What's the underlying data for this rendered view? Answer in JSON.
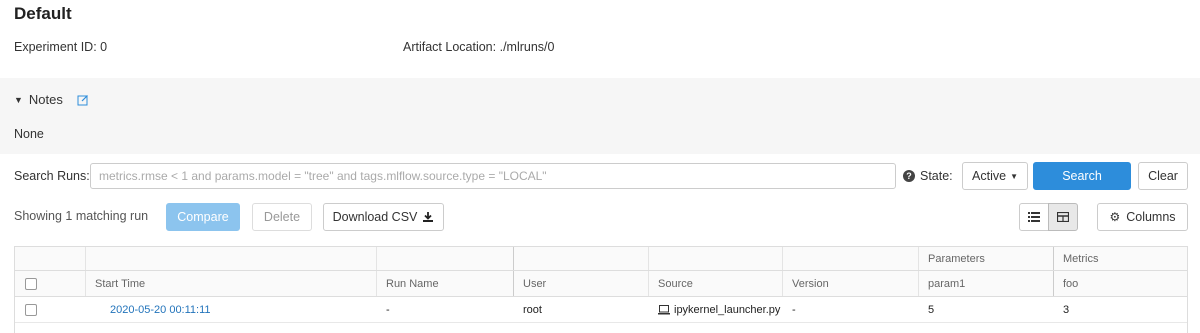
{
  "experiment": {
    "title": "Default",
    "id_label": "Experiment ID:",
    "id_value": "0",
    "artifact_label": "Artifact Location:",
    "artifact_value": "./mlruns/0"
  },
  "notes": {
    "label": "Notes",
    "body": "None"
  },
  "search": {
    "label": "Search Runs:",
    "placeholder": "metrics.rmse < 1 and params.model = \"tree\" and tags.mlflow.source.type = \"LOCAL\"",
    "state_label": "State:",
    "state_value": "Active",
    "search_button": "Search",
    "clear_button": "Clear"
  },
  "toolbar": {
    "showing_text": "Showing 1 matching run",
    "compare_button": "Compare",
    "delete_button": "Delete",
    "download_button": "Download CSV",
    "columns_button": "Columns"
  },
  "table": {
    "group_headers": {
      "parameters": "Parameters",
      "metrics": "Metrics"
    },
    "columns": {
      "start_time": "Start Time",
      "run_name": "Run Name",
      "user": "User",
      "source": "Source",
      "version": "Version",
      "param1": "param1",
      "foo": "foo"
    },
    "rows": [
      {
        "start_time": "2020-05-20 00:11:11",
        "run_name": "-",
        "user": "root",
        "source": "ipykernel_launcher.py",
        "version": "-",
        "param1": "5",
        "foo": "3"
      }
    ]
  },
  "colors": {
    "primary": "#2d8ddb",
    "primary_disabled": "#8cc4ee",
    "link": "#2374bb",
    "notes_bg": "#f6f6f6"
  },
  "icons": {
    "notes_toggle": "caret-down-icon",
    "notes_edit": "edit-icon",
    "help": "help-circle-icon",
    "download": "download-icon",
    "list_view": "list-icon",
    "grid_view": "table-icon",
    "columns": "gear-icon",
    "source": "laptop-icon"
  }
}
